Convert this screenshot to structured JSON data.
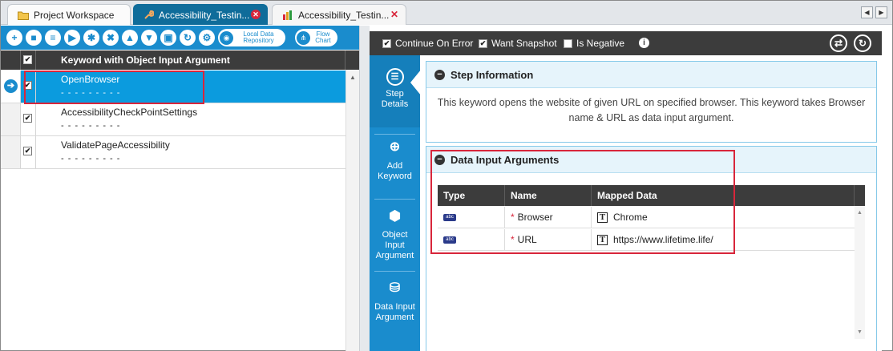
{
  "tabs": [
    {
      "label": "Project Workspace",
      "icon": "folder-icon"
    },
    {
      "label": "Accessibility_Testin...",
      "icon": "wrench-icon",
      "active": true
    },
    {
      "label": "Accessibility_Testin...",
      "icon": "chart-icon"
    }
  ],
  "toolbar": {
    "buttons": [
      "add-icon",
      "record-icon",
      "list-icon",
      "play-icon",
      "debug-icon",
      "delete-icon",
      "move-up-icon",
      "move-down-icon",
      "save-icon",
      "refresh-icon",
      "settings-icon"
    ],
    "local_data_repository_label": "Local Data Repository",
    "flow_chart_label": "Flow Chart"
  },
  "grid": {
    "header": "Keyword with Object Input Argument",
    "rows": [
      {
        "keyword": "OpenBrowser",
        "sub": "- - - - - - - - -",
        "checked": true,
        "selected": true
      },
      {
        "keyword": "AccessibilityCheckPointSettings",
        "sub": "- - - - - - - - -",
        "checked": true
      },
      {
        "keyword": "ValidatePageAccessibility",
        "sub": "- - - - - - - - -",
        "checked": true
      }
    ]
  },
  "options": {
    "continue_on_error": "Continue On Error",
    "want_snapshot": "Want Snapshot",
    "is_negative": "Is Negative"
  },
  "side_nav": {
    "step_details": "Step Details",
    "add_keyword": "Add Keyword",
    "object_input_argument": "Object Input Argument",
    "data_input_argument": "Data Input Argument"
  },
  "step_info": {
    "title": "Step Information",
    "description": "This keyword opens the website of given URL on specified browser. This keyword takes Browser name & URL as data input argument."
  },
  "data_input": {
    "title": "Data Input Arguments",
    "columns": [
      "Type",
      "Name",
      "Mapped Data"
    ],
    "rows": [
      {
        "type": "abc",
        "name": "Browser",
        "value": "Chrome"
      },
      {
        "type": "abc",
        "name": "URL",
        "value": "https://www.lifetime.life/"
      }
    ]
  },
  "colors": {
    "accent": "#1a8ccd",
    "selected_row": "#0b9bde",
    "highlight": "#d8263b",
    "dark_header": "#3c3c3c"
  }
}
